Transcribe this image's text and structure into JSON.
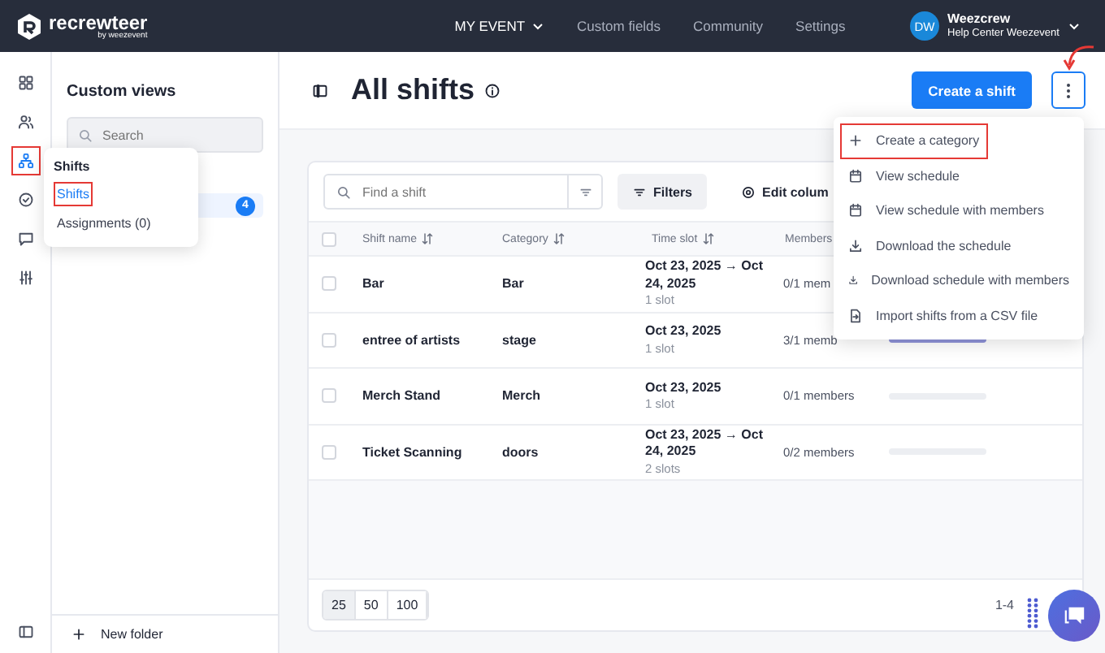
{
  "header": {
    "logo": "recrewteer",
    "logo_tagline": "by weezevent",
    "nav": [
      {
        "label": "MY EVENT",
        "kind": "dropdown"
      },
      {
        "label": "Custom fields",
        "kind": "link"
      },
      {
        "label": "Community",
        "kind": "link"
      },
      {
        "label": "Settings",
        "kind": "link"
      }
    ],
    "user": {
      "initials": "DW",
      "name": "Weezcrew",
      "subtitle": "Help Center Weezevent"
    }
  },
  "rail": {
    "items": [
      {
        "kind": "grid",
        "selected": false,
        "highlighted": false
      },
      {
        "kind": "users",
        "selected": false,
        "highlighted": false
      },
      {
        "kind": "hierarchy",
        "selected": true,
        "highlighted": true
      },
      {
        "kind": "check",
        "selected": false,
        "highlighted": false
      },
      {
        "kind": "message",
        "selected": false,
        "highlighted": false
      },
      {
        "kind": "sliders",
        "selected": false,
        "highlighted": false
      }
    ]
  },
  "sidebar": {
    "title": "Custom views",
    "search": {
      "placeholder": "Search"
    },
    "views": [
      {
        "count": "4",
        "selected": true
      }
    ],
    "new_folder": "New folder"
  },
  "popover": {
    "title": "Shifts",
    "items": [
      {
        "label": "Shifts",
        "selected": true,
        "highlighted": true
      },
      {
        "label": "Assignments (0)",
        "selected": false,
        "highlighted": false
      }
    ]
  },
  "page": {
    "title": "All shifts",
    "primary_button": "Create a shift"
  },
  "menu": {
    "items": [
      {
        "label": "Create a category",
        "kind": "plus",
        "highlighted": true
      },
      {
        "label": "View schedule",
        "kind": "calendar",
        "highlighted": false
      },
      {
        "label": "View schedule with members",
        "kind": "calendar",
        "highlighted": false
      },
      {
        "label": "Download the schedule",
        "kind": "download",
        "highlighted": false
      },
      {
        "label": "Download schedule with members",
        "kind": "download",
        "highlighted": false
      },
      {
        "label": "Import shifts from a CSV file",
        "kind": "import",
        "highlighted": false
      }
    ]
  },
  "toolbar": {
    "search": {
      "placeholder": "Find a shift"
    },
    "filters": "Filters",
    "edit_columns": "Edit colum"
  },
  "table": {
    "select_all_checked": false,
    "columns": [
      {
        "label": "Shift name",
        "sortable": true
      },
      {
        "label": "Category",
        "sortable": true
      },
      {
        "label": "Time slot",
        "sortable": true
      },
      {
        "label": "Members",
        "sortable": false
      }
    ],
    "rows": [
      {
        "name": "Bar",
        "category": "Bar",
        "time": "Oct 23, 2025 → Oct 24, 2025",
        "slots": "1 slot",
        "members": "0/1 mem",
        "checked": false
      },
      {
        "name": "entree of artists",
        "category": "stage",
        "time": "Oct 23, 2025",
        "slots": "1 slot",
        "members": "3/1 memb",
        "checked": false,
        "level": 1
      },
      {
        "name": "Merch Stand",
        "category": "Merch",
        "time": "Oct 23, 2025",
        "slots": "1 slot",
        "members": "0/1 members",
        "checked": false,
        "level": 0
      },
      {
        "name": "Ticket Scanning",
        "category": "doors",
        "time": "Oct 23, 2025 → Oct 24, 2025",
        "slots": "2 slots",
        "members": "0/2 members",
        "checked": false,
        "level": 0
      }
    ]
  },
  "pager": {
    "sizes": [
      {
        "label": "25",
        "selected": true
      },
      {
        "label": "50",
        "selected": false
      },
      {
        "label": "100",
        "selected": false
      }
    ],
    "range": "1-4"
  }
}
